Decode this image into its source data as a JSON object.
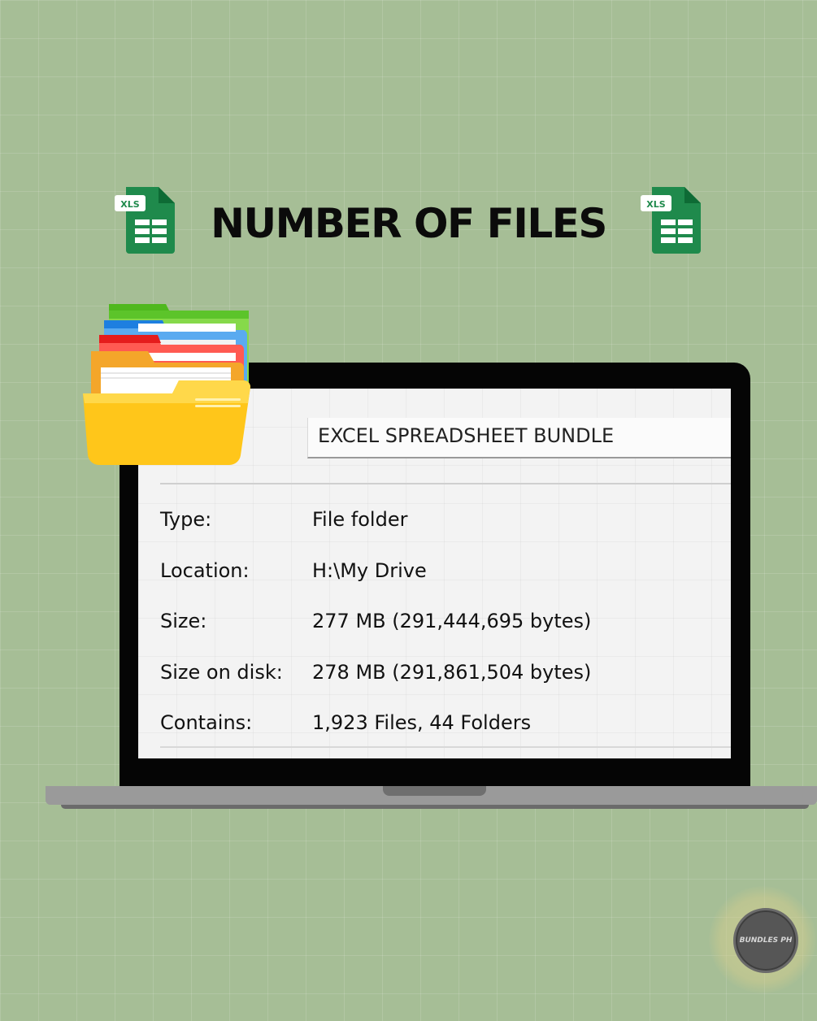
{
  "title": "NUMBER OF FILES",
  "icons": {
    "left_icon": "excel-xls-icon",
    "right_icon": "excel-xls-icon",
    "xls_badge": "XLS",
    "folder": "folder-icon"
  },
  "properties_window": {
    "folder_name": "EXCEL SPREADSHEET BUNDLE",
    "rows": [
      {
        "label": "Type:",
        "value": "File folder"
      },
      {
        "label": "Location:",
        "value": "H:\\My Drive"
      },
      {
        "label": "Size:",
        "value": "277 MB (291,444,695 bytes)"
      },
      {
        "label": "Size on disk:",
        "value": "278 MB (291,861,504 bytes)"
      },
      {
        "label": "Contains:",
        "value": "1,923 Files, 44 Folders"
      }
    ]
  },
  "watermark": {
    "text": "BUNDLES PH"
  },
  "colors": {
    "background": "#a6be96",
    "excel_green": "#1f8a4c",
    "excel_dark_green": "#0e6b35",
    "folder_yellow": "#ffc61a"
  }
}
